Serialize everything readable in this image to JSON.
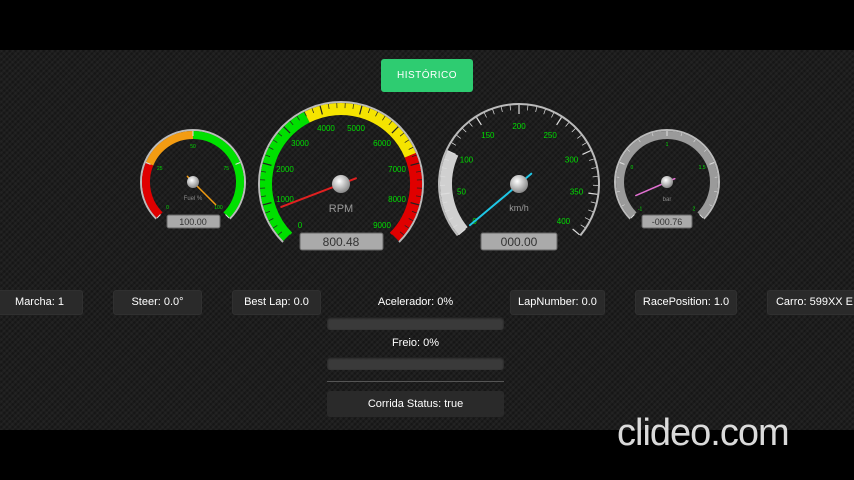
{
  "historico_label": "HISTÓRICO",
  "gauges": {
    "fuel": {
      "title": "Fuel %",
      "ticks": [
        "0",
        "25",
        "50",
        "75",
        "100"
      ],
      "readout": "100.00",
      "value": 100,
      "min": 0,
      "max": 100
    },
    "rpm": {
      "title": "RPM",
      "ticks": [
        "0",
        "1000",
        "2000",
        "3000",
        "4000",
        "5000",
        "6000",
        "7000",
        "8000",
        "9000"
      ],
      "readout": "800.48",
      "value": 800.48,
      "min": 0,
      "max": 9000
    },
    "speed": {
      "title": "km/h",
      "ticks": [
        "0",
        "50",
        "100",
        "150",
        "200",
        "250",
        "300",
        "350",
        "400"
      ],
      "readout": "000.00",
      "value": 0,
      "min": 0,
      "max": 400
    },
    "boost": {
      "title": "bar",
      "ticks": [
        "-1",
        "0",
        "1",
        "1.5",
        "2"
      ],
      "readout": "-000.76",
      "value": -0.76,
      "min": -1,
      "max": 2
    }
  },
  "status": {
    "marcha": "Marcha: 1",
    "steer": "Steer: 0.0°",
    "best_lap": "Best Lap: 0.0",
    "lap_number": "LapNumber: 0.0",
    "race_position": "RacePosition: 1.0",
    "carro": "Carro: 599XX E"
  },
  "acelerador": {
    "label": "Acelerador: 0%",
    "value": 0
  },
  "freio": {
    "label": "Freio: 0%",
    "value": 0
  },
  "corrida_status": "Corrida Status: true",
  "watermark": "clideo.com",
  "colors": {
    "accent": "#2ecc71",
    "green": "#00e000",
    "yellow": "#f5e400",
    "orange": "#f39c12",
    "red": "#e00000",
    "tick_label": "#00dd00",
    "needle_rpm": "#e02020",
    "needle_speed": "#1fc7e6",
    "needle_fuel": "#f39c12",
    "needle_boost": "#e070d0"
  }
}
